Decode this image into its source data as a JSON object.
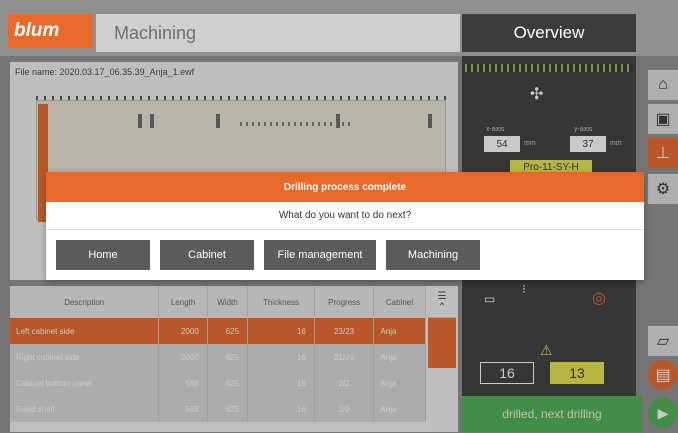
{
  "header": {
    "logo": "blum",
    "title": "Machining",
    "overview": "Overview"
  },
  "canvas": {
    "file_name": "File name: 2020.03.17_06.35.39_Anja_1.ewf"
  },
  "table": {
    "headers": [
      "Description",
      "Length",
      "Width",
      "Thickness",
      "Progress",
      "Cabinet"
    ],
    "rows": [
      {
        "description": "Left cabinet side",
        "length": "2000",
        "width": "625",
        "thickness": "16",
        "progress": "23/23",
        "cabinet": "Anja",
        "selected": true
      },
      {
        "description": "Right cabinet side",
        "length": "2000",
        "width": "625",
        "thickness": "16",
        "progress": "21/21",
        "cabinet": "Anja",
        "selected": false
      },
      {
        "description": "Cabinet bottom panel",
        "length": "568",
        "width": "625",
        "thickness": "16",
        "progress": "2/2",
        "cabinet": "Anja",
        "selected": false
      },
      {
        "description": "Fixed shelf",
        "length": "568",
        "width": "625",
        "thickness": "16",
        "progress": "2/2",
        "cabinet": "Anja",
        "selected": false
      }
    ]
  },
  "right_panel": {
    "x_axis_label": "x-axis",
    "y_axis_label": "y-axis",
    "x_value": "54",
    "y_value": "37",
    "unit": "mm",
    "program": "Pro-11-SY-H",
    "counter_a": "16",
    "counter_b": "13",
    "status": "drilled, next drilling"
  },
  "modal": {
    "title": "Drilling process complete",
    "subtitle": "What do you want to do next?",
    "buttons": [
      "Home",
      "Cabinet",
      "File management",
      "Machining"
    ]
  },
  "colors": {
    "accent": "#e8692a",
    "dark_panel": "#3b3b3b",
    "status_green": "#4caf50",
    "highlight_yellow": "#e6e84a"
  }
}
